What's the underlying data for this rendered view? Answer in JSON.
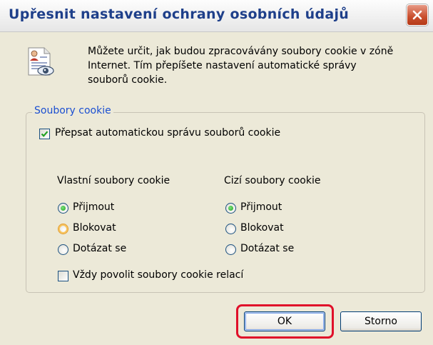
{
  "window": {
    "title": "Upřesnit nastavení ochrany osobních údajů",
    "close_icon": "close-icon"
  },
  "intro": {
    "icon": "privacy-document-eye-icon",
    "lines": [
      "Můžete určit, jak budou zpracovávány soubory cookie v zóně",
      "Internet. Tím přepíšete nastavení automatické správy",
      "souborů cookie."
    ]
  },
  "cookies_group": {
    "legend": "Soubory cookie",
    "override": {
      "label": "Přepsat automatickou správu souborů cookie",
      "checked": true
    },
    "first_party": {
      "heading": "Vlastní soubory cookie",
      "options": [
        "Přijmout",
        "Blokovat",
        "Dotázat se"
      ],
      "selected": "Přijmout"
    },
    "third_party": {
      "heading": "Cizí soubory cookie",
      "options": [
        "Přijmout",
        "Blokovat",
        "Dotázat se"
      ],
      "selected": "Přijmout"
    },
    "session": {
      "label": "Vždy povolit soubory cookie relací",
      "checked": false
    }
  },
  "buttons": {
    "ok": "OK",
    "cancel": "Storno"
  },
  "colors": {
    "title_text": "#1e3f8a",
    "legend_text": "#1b4fd1",
    "dialog_bg": "#ece9d8",
    "highlight": "#e0102a",
    "close_button": "#c94e2d"
  }
}
